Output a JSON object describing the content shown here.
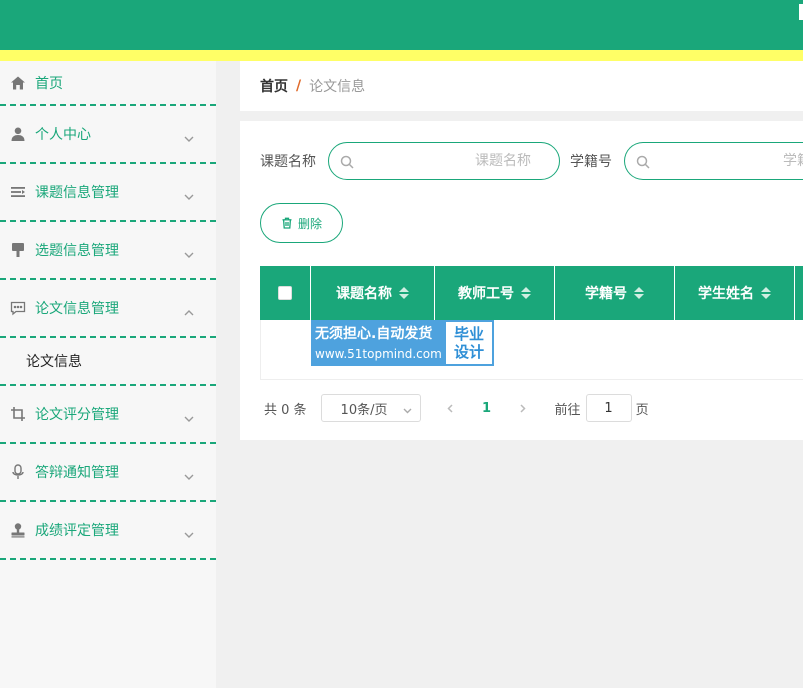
{
  "sidebar": {
    "items": [
      {
        "label": "首页",
        "icon": "home-icon"
      },
      {
        "label": "个人中心",
        "icon": "user-icon"
      },
      {
        "label": "课题信息管理",
        "icon": "list-icon"
      },
      {
        "label": "选题信息管理",
        "icon": "brush-icon"
      },
      {
        "label": "论文信息管理",
        "icon": "chat-icon"
      },
      {
        "label": "论文评分管理",
        "icon": "crop-icon"
      },
      {
        "label": "答辩通知管理",
        "icon": "microphone-icon"
      },
      {
        "label": "成绩评定管理",
        "icon": "stamp-icon"
      }
    ],
    "submenu": {
      "label": "论文信息"
    }
  },
  "breadcrumb": {
    "home": "首页",
    "separator": "/",
    "current": "论文信息"
  },
  "search": {
    "topic_label": "课题名称",
    "topic_placeholder": "课题名称",
    "student_id_label": "学籍号",
    "student_id_placeholder": "学籍号"
  },
  "toolbar": {
    "delete_label": "删除"
  },
  "table": {
    "columns": [
      "课题名称",
      "教师工号",
      "学籍号",
      "学生姓名"
    ]
  },
  "watermark": {
    "line1": "无须担心.自动发货",
    "line2": "www.51topmind.com",
    "badge_line1": "毕业",
    "badge_line2": "设计"
  },
  "pagination": {
    "total": "共 0 条",
    "page_size": "10条/页",
    "current_page": "1",
    "goto_label": "前往",
    "goto_value": "1",
    "page_suffix": "页"
  },
  "colors": {
    "accent": "#1aa77a",
    "header_stripe": "#ffff66",
    "watermark": "#4ea2de"
  }
}
